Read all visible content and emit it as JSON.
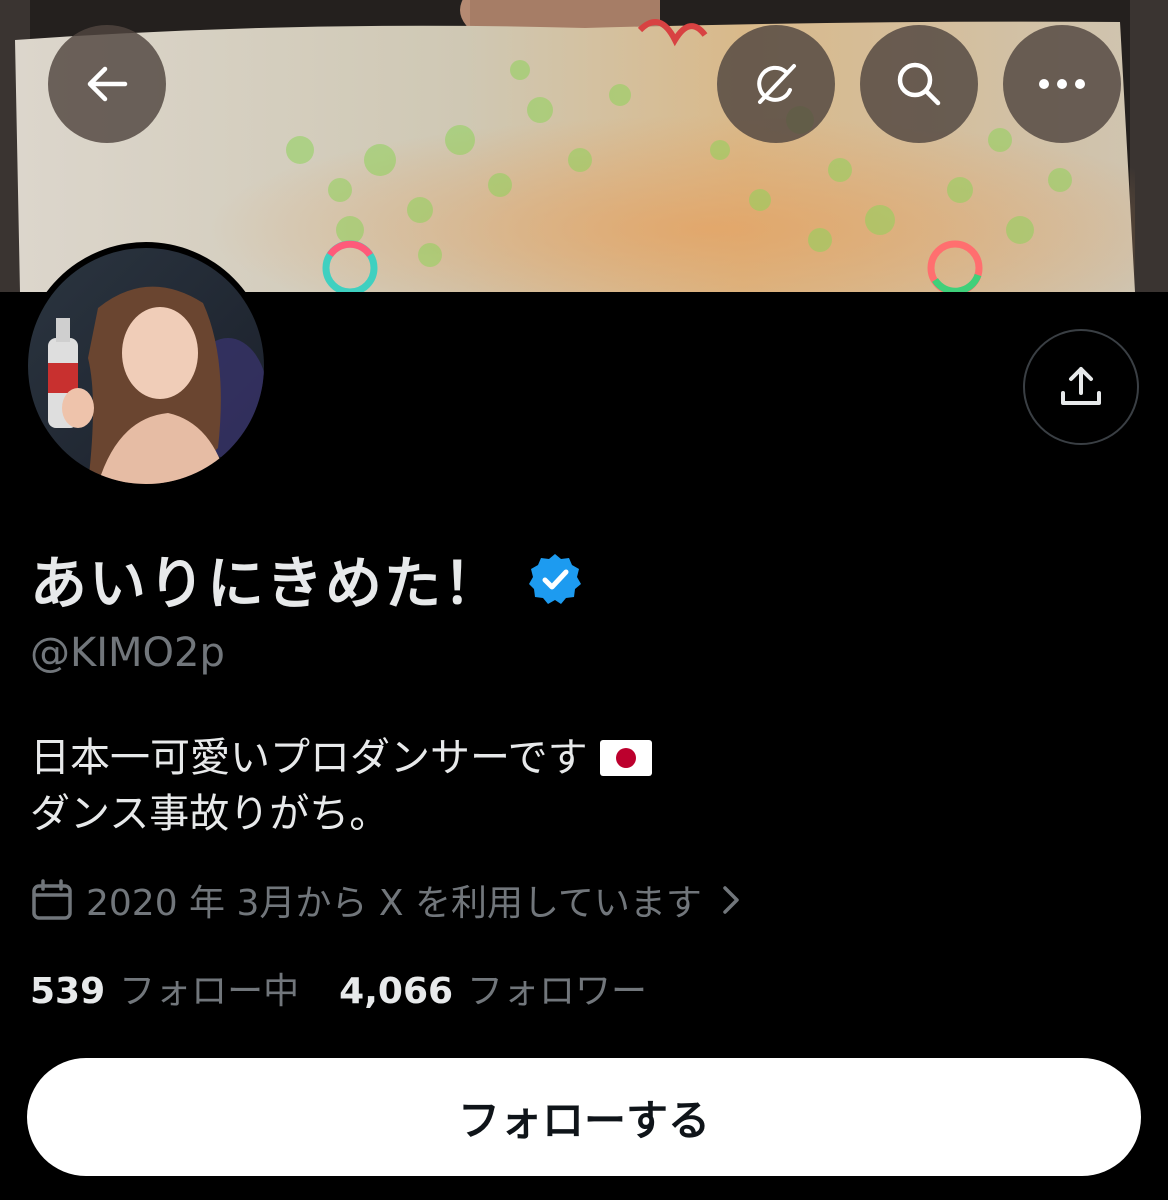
{
  "header": {
    "back_icon": "arrow-left-icon",
    "grok_icon": "grok-icon",
    "search_icon": "search-icon",
    "more_icon": "more-horizontal-icon"
  },
  "share_icon": "share-icon",
  "profile": {
    "display_name": "あいりにきめた！",
    "verified_icon": "verified-badge-icon",
    "verified_color": "#1d9bf0",
    "handle": "@KIMO2p",
    "bio": {
      "line1": "日本一可愛いプロダンサーです",
      "line1_emoji": "japan-flag-icon",
      "line2": "ダンス事故りがち。"
    },
    "joined": "2020 年 3月から X を利用しています",
    "stats": {
      "following_count": "539",
      "following_label": "フォロー中",
      "followers_count": "4,066",
      "followers_label": "フォロワー"
    }
  },
  "actions": {
    "follow_label": "フォローする"
  }
}
